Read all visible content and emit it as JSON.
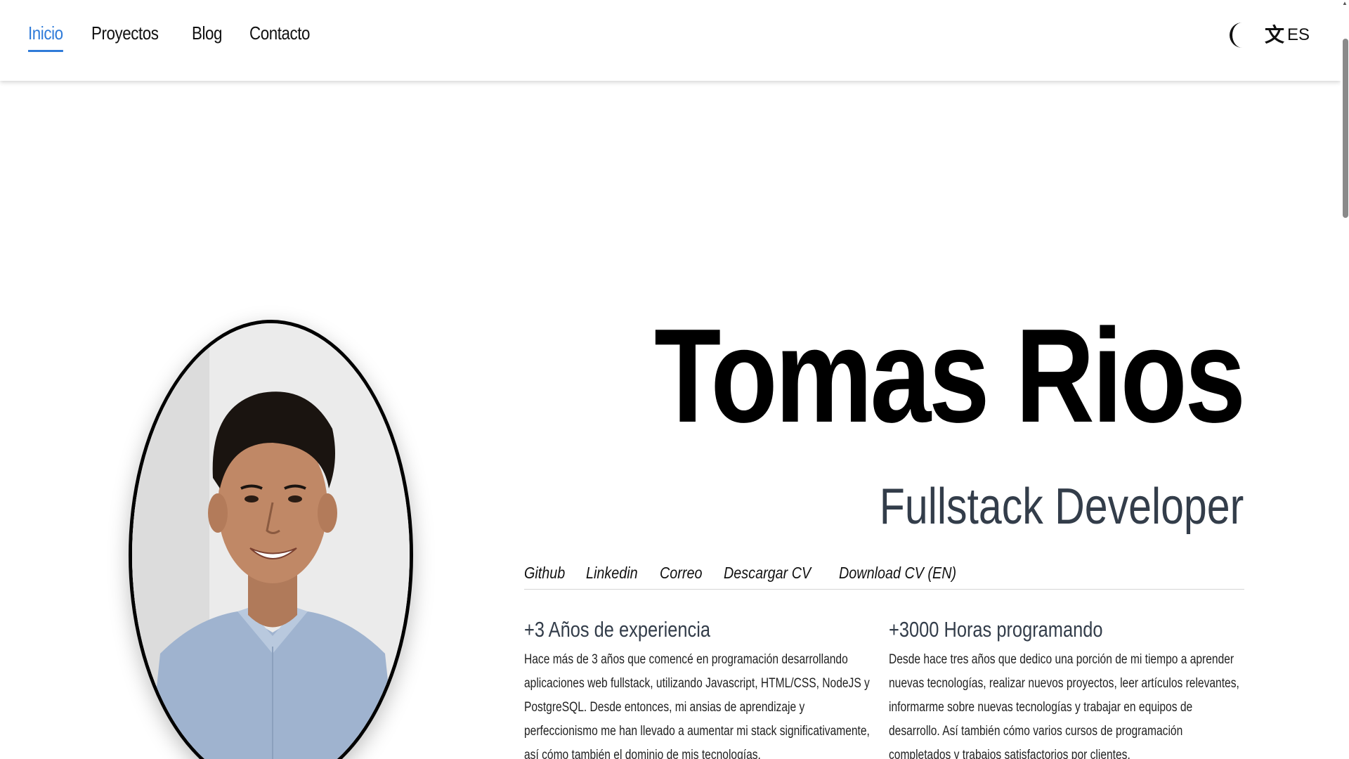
{
  "nav": {
    "items": [
      {
        "label": "Inicio",
        "active": true
      },
      {
        "label": "Proyectos",
        "active": false
      },
      {
        "label": "Blog",
        "active": false
      },
      {
        "label": "Contacto",
        "active": false
      }
    ],
    "theme_icon": "moon-icon",
    "language_icon": "translate-icon",
    "language_label": "ES"
  },
  "hero": {
    "name": "Tomas Rios",
    "role": "Fullstack Developer",
    "links": [
      "Github",
      "Linkedin",
      "Correo",
      "Descargar CV",
      "Download CV (EN)"
    ]
  },
  "stats": [
    {
      "title": "+3 Años de experiencia",
      "text": "Hace más de 3 años que comencé en programación desarrollando aplicaciones web fullstack, utilizando Javascript, HTML/CSS, NodeJS y PostgreSQL. Desde entonces, mi ansias de aprendizaje y perfeccionismo me han llevado a aumentar mi stack significativamente, así cómo también el dominio de mis tecnologías."
    },
    {
      "title": "+3000 Horas programando",
      "text": "Desde hace tres años que dedico una porción de mi tiempo a aprender nuevas tecnologías, realizar nuevos proyectos, leer artículos relevantes, informarme sobre nuevas tecnologías y trabajar en equipos de desarrollo. Así también cómo varios cursos de programación completados y trabajos satisfactorios por clientes."
    }
  ],
  "colors": {
    "accent": "#2f7bd9",
    "role_text": "#333d4a"
  }
}
